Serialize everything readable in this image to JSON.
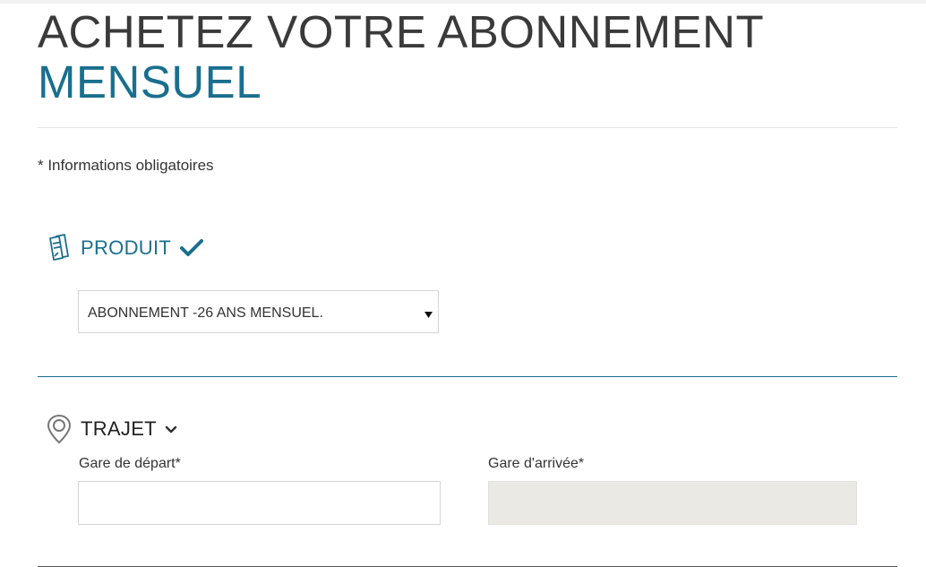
{
  "header": {
    "title_line1": "ACHETEZ VOTRE ABONNEMENT",
    "title_line2": "MENSUEL"
  },
  "form": {
    "required_note": "* Informations obligatoires",
    "produit": {
      "title": "PRODUIT",
      "icon": "ticket-icon",
      "status_icon": "checkmark-icon",
      "selected_value": "ABONNEMENT -26 ANS MENSUEL."
    },
    "trajet": {
      "title": "TRAJET",
      "icon": "map-pin-icon",
      "toggle_icon": "chevron-down-icon",
      "depart_label": "Gare de départ*",
      "depart_value": "",
      "arrivee_label": "Gare d'arrivée*",
      "arrivee_value": ""
    }
  },
  "colors": {
    "accent": "#1a6f8e",
    "disabled_field": "#eae9e3",
    "text": "#333333"
  }
}
